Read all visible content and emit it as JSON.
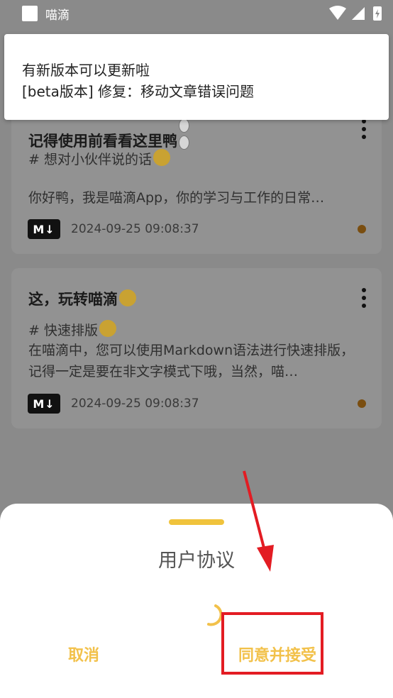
{
  "status_bar": {
    "app_name": "喵滴"
  },
  "notes": [
    {
      "title": "记得使用前看看这里鸭",
      "tag": "# 想对小伙伴说的话",
      "text": "你好鸭，我是喵滴App，你的学习与工作的日常…",
      "format_badge": "M↓",
      "date": "2024-09-25 09:08:37"
    },
    {
      "title": "这，玩转喵滴",
      "tag": "# 快速排版",
      "text": "在喵滴中，您可以使用Markdown语法进行快速排版，记得一定是要在非文字模式下哦，当然，喵…",
      "format_badge": "M↓",
      "date": "2024-09-25 09:08:37"
    }
  ],
  "toast": {
    "line1": "有新版本可以更新啦",
    "line2": "[beta版本] 修复：移动文章错误问题"
  },
  "dialog": {
    "title": "用户协议",
    "cancel_label": "取消",
    "agree_label": "同意并接受"
  },
  "colors": {
    "accent": "#f2c14a",
    "annotation": "#e31c23",
    "overlay": "#8a8a8a"
  }
}
